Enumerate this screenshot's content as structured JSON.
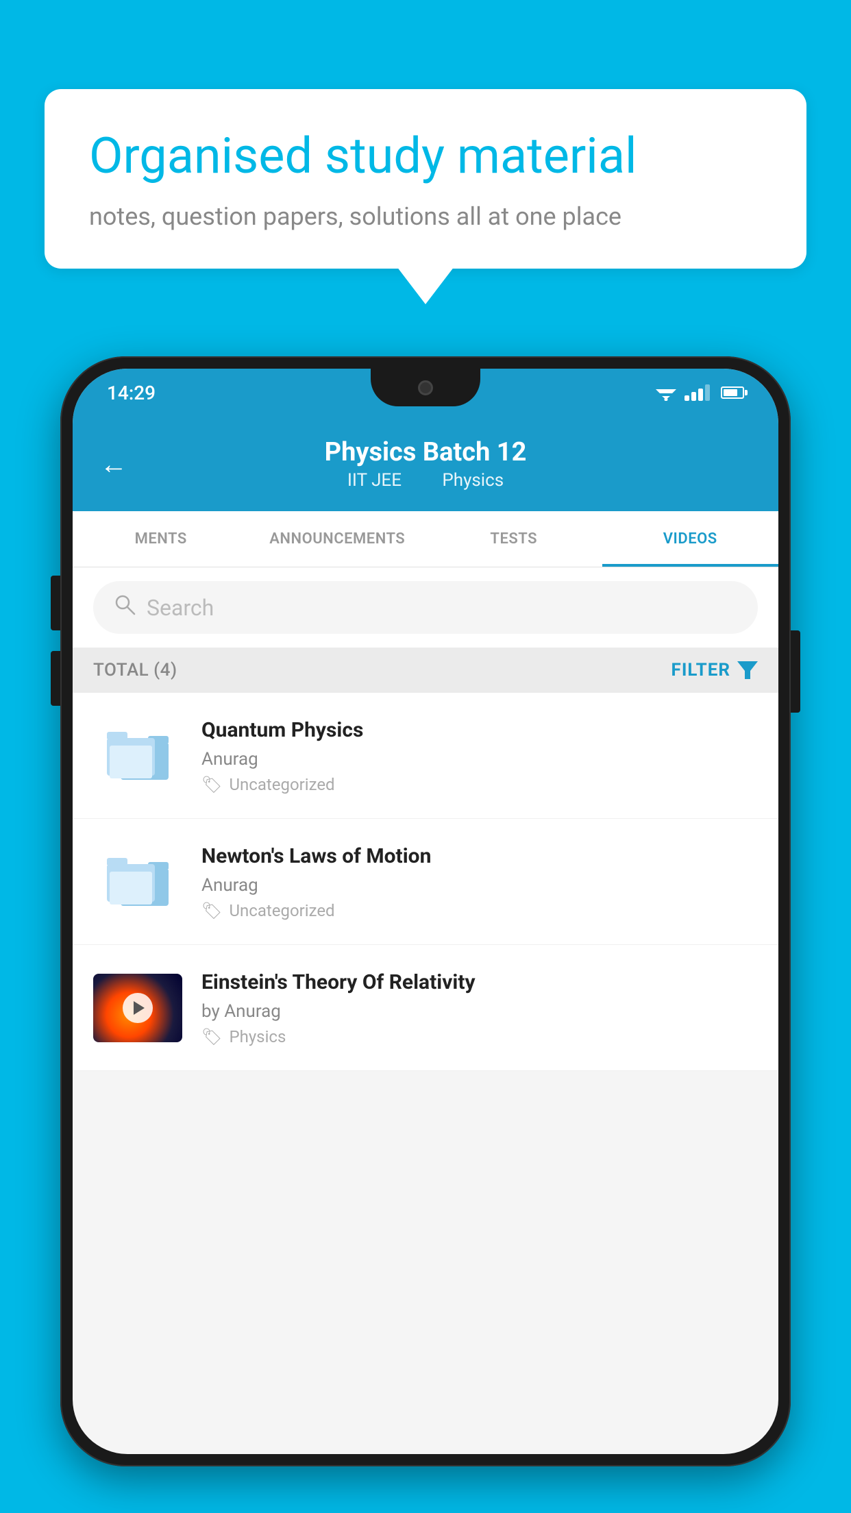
{
  "background_color": "#00b8e6",
  "speech_bubble": {
    "title": "Organised study material",
    "subtitle": "notes, question papers, solutions all at one place"
  },
  "status_bar": {
    "time": "14:29"
  },
  "app_header": {
    "title": "Physics Batch 12",
    "subtitle_part1": "IIT JEE",
    "subtitle_part2": "Physics",
    "back_label": "←"
  },
  "tabs": [
    {
      "label": "MENTS",
      "active": false
    },
    {
      "label": "ANNOUNCEMENTS",
      "active": false
    },
    {
      "label": "TESTS",
      "active": false
    },
    {
      "label": "VIDEOS",
      "active": true
    }
  ],
  "search": {
    "placeholder": "Search"
  },
  "filter_bar": {
    "total_label": "TOTAL (4)",
    "filter_label": "FILTER"
  },
  "videos": [
    {
      "id": 1,
      "title": "Quantum Physics",
      "author": "Anurag",
      "tag": "Uncategorized",
      "has_thumbnail": false
    },
    {
      "id": 2,
      "title": "Newton's Laws of Motion",
      "author": "Anurag",
      "tag": "Uncategorized",
      "has_thumbnail": false
    },
    {
      "id": 3,
      "title": "Einstein's Theory Of Relativity",
      "author": "by Anurag",
      "tag": "Physics",
      "has_thumbnail": true
    }
  ]
}
